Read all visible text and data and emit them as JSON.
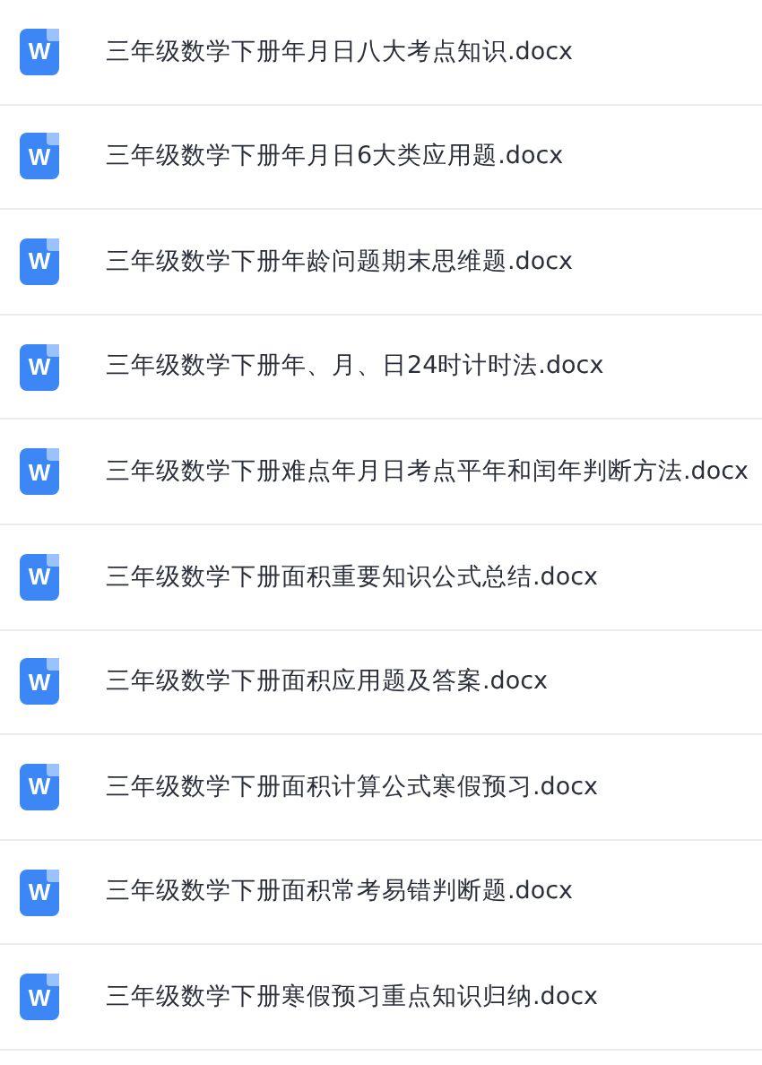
{
  "files": [
    {
      "icon_text": "W",
      "name": "三年级数学下册年月日八大考点知识.docx"
    },
    {
      "icon_text": "W",
      "name": "三年级数学下册年月日6大类应用题.docx"
    },
    {
      "icon_text": "W",
      "name": "三年级数学下册年龄问题期末思维题.docx"
    },
    {
      "icon_text": "W",
      "name": "三年级数学下册年、月、日24时计时法.docx"
    },
    {
      "icon_text": "W",
      "name": "三年级数学下册难点年月日考点平年和闰年判断方法.docx"
    },
    {
      "icon_text": "W",
      "name": "三年级数学下册面积重要知识公式总结.docx"
    },
    {
      "icon_text": "W",
      "name": "三年级数学下册面积应用题及答案.docx"
    },
    {
      "icon_text": "W",
      "name": "三年级数学下册面积计算公式寒假预习.docx"
    },
    {
      "icon_text": "W",
      "name": "三年级数学下册面积常考易错判断题.docx"
    },
    {
      "icon_text": "W",
      "name": "三年级数学下册寒假预习重点知识归纳.docx"
    }
  ]
}
